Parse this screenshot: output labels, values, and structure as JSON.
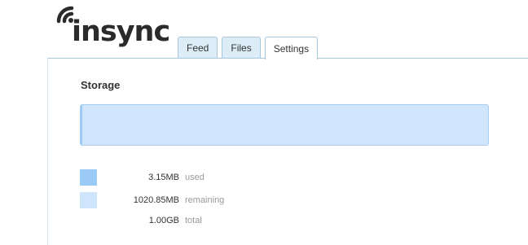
{
  "logo": {
    "text": "insync",
    "icon": "wifi-waves-icon"
  },
  "tabs": [
    {
      "label": "Feed",
      "active": false
    },
    {
      "label": "Files",
      "active": false
    },
    {
      "label": "Settings",
      "active": true
    }
  ],
  "storage": {
    "title": "Storage",
    "used_fraction": 0.003,
    "used": {
      "value": "3.15MB",
      "label": "used",
      "color": "#9ccaf6"
    },
    "remaining": {
      "value": "1020.85MB",
      "label": "remaining",
      "color": "#cfe5fb"
    },
    "total": {
      "value": "1.00GB",
      "label": "total"
    }
  },
  "colors": {
    "accent_border": "#a7c6da",
    "tab_bg": "#dcedf8"
  }
}
